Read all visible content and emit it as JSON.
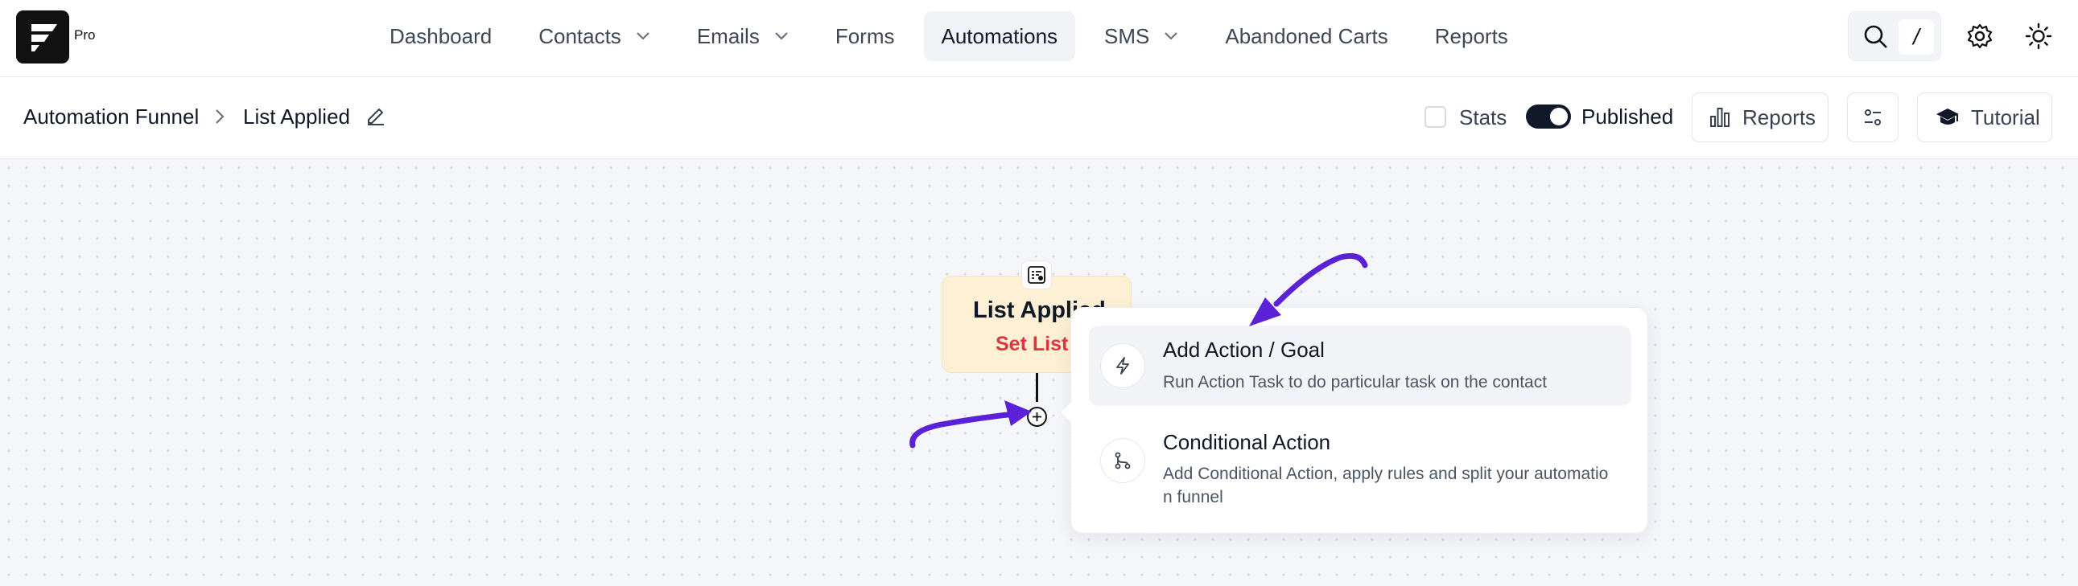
{
  "brand": {
    "badge": "Pro"
  },
  "nav": {
    "items": [
      {
        "label": "Dashboard",
        "dropdown": false,
        "active": false
      },
      {
        "label": "Contacts",
        "dropdown": true,
        "active": false
      },
      {
        "label": "Emails",
        "dropdown": true,
        "active": false
      },
      {
        "label": "Forms",
        "dropdown": false,
        "active": false
      },
      {
        "label": "Automations",
        "dropdown": false,
        "active": true
      },
      {
        "label": "SMS",
        "dropdown": true,
        "active": false
      },
      {
        "label": "Abandoned Carts",
        "dropdown": false,
        "active": false
      },
      {
        "label": "Reports",
        "dropdown": false,
        "active": false
      }
    ],
    "shortcut_key": "/"
  },
  "breadcrumb": {
    "parent": "Automation Funnel",
    "current": "List Applied"
  },
  "toolbar": {
    "stats_label": "Stats",
    "stats_checked": false,
    "published_label": "Published",
    "published_on": true,
    "reports_label": "Reports",
    "tutorial_label": "Tutorial"
  },
  "trigger_node": {
    "title": "List Applied",
    "subtitle": "Set List"
  },
  "action_menu": {
    "options": [
      {
        "title": "Add Action / Goal",
        "description": "Run Action Task to do particular task on the contact",
        "icon": "bolt-icon",
        "highlighted": true
      },
      {
        "title": "Conditional Action",
        "description": "Add Conditional Action, apply rules and split your automation funnel",
        "icon": "branch-icon",
        "highlighted": false
      }
    ]
  },
  "colors": {
    "accent_arrow": "#5b21d6",
    "node_bg": "#fdf0d5",
    "node_subtitle": "#e0353f",
    "toggle_on": "#111827"
  }
}
